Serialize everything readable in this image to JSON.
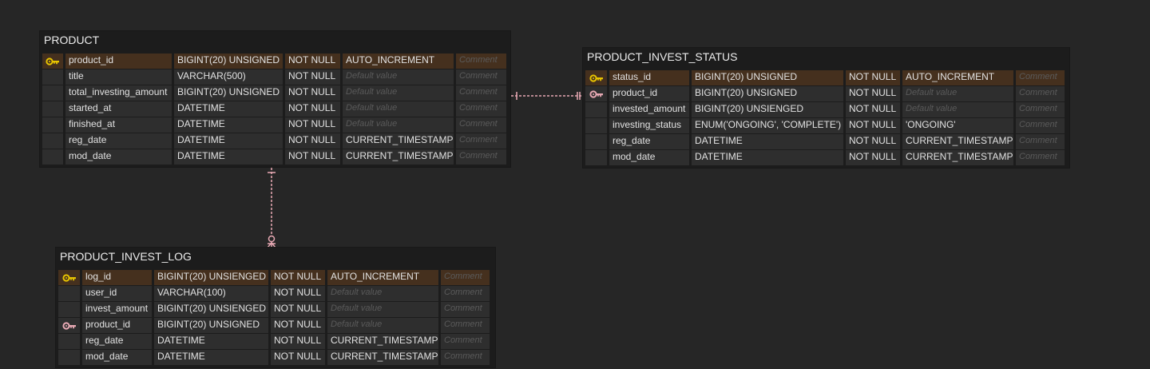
{
  "colors": {
    "background": "#262626",
    "relation": "#e8a9b4",
    "pk_key": "#e8c400",
    "fk_key": "#e8a9b4",
    "pk_row": "#45301e"
  },
  "placeholders": {
    "default": "Default value",
    "comment": "Comment"
  },
  "tables": [
    {
      "id": "product",
      "name": "PRODUCT",
      "columns": [
        {
          "key": "pk",
          "name": "product_id",
          "type": "BIGINT(20) UNSIGNED",
          "null": "NOT NULL",
          "default": "AUTO_INCREMENT"
        },
        {
          "key": "",
          "name": "title",
          "type": "VARCHAR(500)",
          "null": "NOT NULL",
          "default": ""
        },
        {
          "key": "",
          "name": "total_investing_amount",
          "type": "BIGINT(20) UNSIGNED",
          "null": "NOT NULL",
          "default": ""
        },
        {
          "key": "",
          "name": "started_at",
          "type": "DATETIME",
          "null": "NOT NULL",
          "default": ""
        },
        {
          "key": "",
          "name": "finished_at",
          "type": "DATETIME",
          "null": "NOT NULL",
          "default": ""
        },
        {
          "key": "",
          "name": "reg_date",
          "type": "DATETIME",
          "null": "NOT NULL",
          "default": "CURRENT_TIMESTAMP"
        },
        {
          "key": "",
          "name": "mod_date",
          "type": "DATETIME",
          "null": "NOT NULL",
          "default": "CURRENT_TIMESTAMP"
        }
      ]
    },
    {
      "id": "status",
      "name": "PRODUCT_INVEST_STATUS",
      "columns": [
        {
          "key": "pk",
          "name": "status_id",
          "type": "BIGINT(20) UNSIGNED",
          "null": "NOT NULL",
          "default": "AUTO_INCREMENT"
        },
        {
          "key": "fk",
          "name": "product_id",
          "type": "BIGINT(20) UNSIGNED",
          "null": "NOT NULL",
          "default": ""
        },
        {
          "key": "",
          "name": "invested_amount",
          "type": "BIGINT(20) UNSIENGED",
          "null": "NOT NULL",
          "default": ""
        },
        {
          "key": "",
          "name": "investing_status",
          "type": "ENUM('ONGOING', 'COMPLETE')",
          "null": "NOT NULL",
          "default": "'ONGOING'"
        },
        {
          "key": "",
          "name": "reg_date",
          "type": "DATETIME",
          "null": "NOT NULL",
          "default": "CURRENT_TIMESTAMP"
        },
        {
          "key": "",
          "name": "mod_date",
          "type": "DATETIME",
          "null": "NOT NULL",
          "default": "CURRENT_TIMESTAMP"
        }
      ]
    },
    {
      "id": "log",
      "name": "PRODUCT_INVEST_LOG",
      "columns": [
        {
          "key": "pk",
          "name": "log_id",
          "type": "BIGINT(20) UNSIENGED",
          "null": "NOT NULL",
          "default": "AUTO_INCREMENT"
        },
        {
          "key": "",
          "name": "user_id",
          "type": "VARCHAR(100)",
          "null": "NOT NULL",
          "default": ""
        },
        {
          "key": "",
          "name": "invest_amount",
          "type": "BIGINT(20) UNSIENGED",
          "null": "NOT NULL",
          "default": ""
        },
        {
          "key": "fk",
          "name": "product_id",
          "type": "BIGINT(20) UNSIGNED",
          "null": "NOT NULL",
          "default": ""
        },
        {
          "key": "",
          "name": "reg_date",
          "type": "DATETIME",
          "null": "NOT NULL",
          "default": "CURRENT_TIMESTAMP"
        },
        {
          "key": "",
          "name": "mod_date",
          "type": "DATETIME",
          "null": "NOT NULL",
          "default": "CURRENT_TIMESTAMP"
        }
      ]
    }
  ],
  "relations": [
    {
      "from": "PRODUCT.product_id",
      "to": "PRODUCT_INVEST_STATUS.product_id",
      "cardinality": "one-to-one"
    },
    {
      "from": "PRODUCT.product_id",
      "to": "PRODUCT_INVEST_LOG.product_id",
      "cardinality": "one-to-zero-or-many"
    }
  ]
}
